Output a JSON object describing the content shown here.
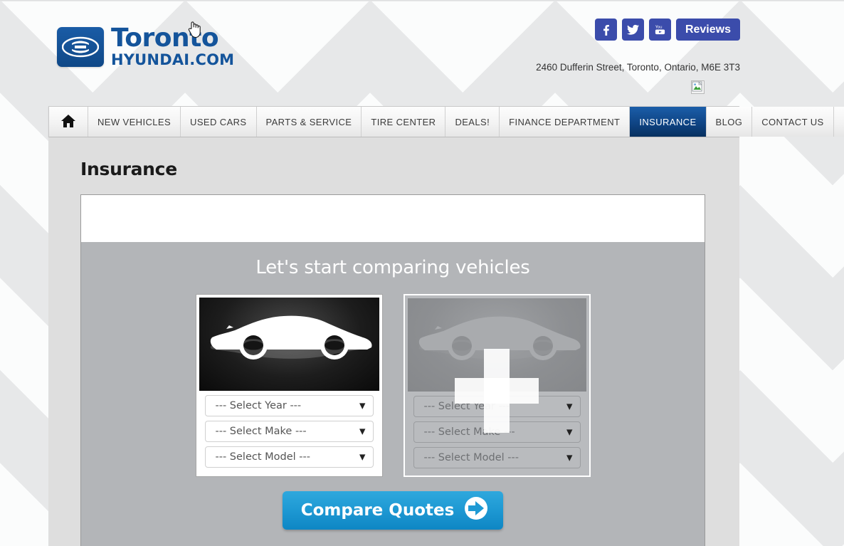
{
  "header": {
    "logo": {
      "mark_icon": "hyundai-logo-icon",
      "line1": "Toronto",
      "line2": "HYUNDAI.COM"
    },
    "social": [
      {
        "name": "facebook-icon",
        "label": "f"
      },
      {
        "name": "twitter-icon",
        "label": "t"
      },
      {
        "name": "youtube-icon",
        "label": "yt"
      }
    ],
    "reviews_label": "Reviews",
    "address": "2460 Dufferin Street, Toronto, Ontario, M6E 3T3",
    "broken_image_alt": "broken-image-icon",
    "accent_blue": "#3b4cab"
  },
  "nav": {
    "home_icon": "home-icon",
    "items": [
      {
        "label": "NEW VEHICLES",
        "active": false
      },
      {
        "label": "USED CARS",
        "active": false
      },
      {
        "label": "PARTS & SERVICE",
        "active": false
      },
      {
        "label": "TIRE CENTER",
        "active": false
      },
      {
        "label": "DEALS!",
        "active": false
      },
      {
        "label": "FINANCE DEPARTMENT",
        "active": false
      },
      {
        "label": "INSURANCE",
        "active": true
      },
      {
        "label": "BLOG",
        "active": false
      },
      {
        "label": "CONTACT US",
        "active": false
      }
    ],
    "active_color": "#0e4281"
  },
  "page": {
    "title": "Insurance"
  },
  "widget": {
    "heading": "Let's start comparing vehicles",
    "cards": [
      {
        "id": "vehicle-1",
        "state": "active",
        "car_icon": "car-silhouette-icon",
        "selects": [
          {
            "name": "select-year",
            "value": "--- Select Year ---"
          },
          {
            "name": "select-make",
            "value": "--- Select Make ---"
          },
          {
            "name": "select-model",
            "value": "--- Select Model ---"
          }
        ]
      },
      {
        "id": "vehicle-2",
        "state": "disabled",
        "car_icon": "car-silhouette-icon",
        "overlay_icon": "plus-icon",
        "selects": [
          {
            "name": "select-year",
            "value": "--- Select Year ---"
          },
          {
            "name": "select-make",
            "value": "--- Select Make ---"
          },
          {
            "name": "select-model",
            "value": "--- Select Model ---"
          }
        ]
      }
    ],
    "compare_button": {
      "label": "Compare Quotes",
      "icon": "arrow-circle-right-icon",
      "color": "#1f9ad4"
    },
    "panel_color": "#b3b5b8"
  },
  "cursor": {
    "type": "pointer-hand-cursor"
  }
}
